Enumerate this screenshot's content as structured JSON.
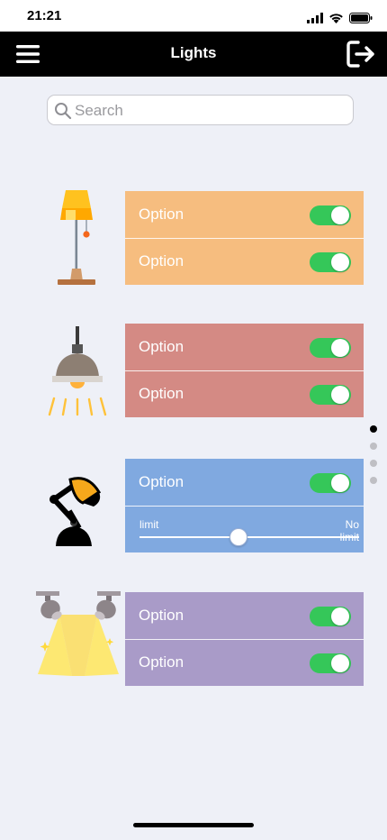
{
  "status": {
    "time": "21:21"
  },
  "nav": {
    "title": "Lights"
  },
  "search": {
    "placeholder": "Search",
    "value": ""
  },
  "lights": [
    {
      "icon": "floor-lamp-icon",
      "color": "#f6bd7f",
      "options": [
        {
          "label": "Option",
          "on": true
        },
        {
          "label": "Option",
          "on": true
        }
      ]
    },
    {
      "icon": "ceiling-lamp-icon",
      "color": "#d48a84",
      "options": [
        {
          "label": "Option",
          "on": true
        },
        {
          "label": "Option",
          "on": true
        }
      ]
    },
    {
      "icon": "desk-lamp-icon",
      "color": "#80a9e0",
      "options": [
        {
          "label": "Option",
          "on": true
        }
      ],
      "slider": {
        "min_label": "limit",
        "max_label": "No limit",
        "value": 0.45
      }
    },
    {
      "icon": "spotlights-icon",
      "color": "#a99bc8",
      "options": [
        {
          "label": "Option",
          "on": true
        },
        {
          "label": "Option",
          "on": true
        }
      ]
    }
  ],
  "pager": {
    "count": 4,
    "active": 0
  }
}
